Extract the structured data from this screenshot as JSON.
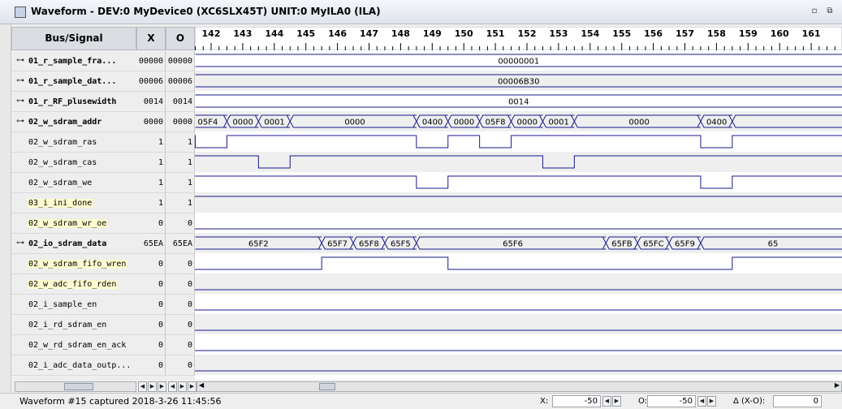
{
  "window": {
    "title": "Waveform - DEV:0 MyDevice0 (XC6SLX45T) UNIT:0 MyILA0 (ILA)",
    "minimize_glyph": "▫",
    "maximize_glyph": "⧉"
  },
  "headers": {
    "bus_signal": "Bus/Signal",
    "x": "X",
    "o": "O"
  },
  "timeline": {
    "first_tick": 142,
    "last_tick": 161,
    "tick_labels": [
      "142",
      "143",
      "144",
      "145",
      "146",
      "147",
      "148",
      "149",
      "150",
      "151",
      "152",
      "153",
      "154",
      "155",
      "156",
      "157",
      "158",
      "159",
      "160",
      "161"
    ]
  },
  "signals": [
    {
      "name": "01_r_sample_fra...",
      "bus": true,
      "highlight": false,
      "x": "00000",
      "o": "00000",
      "kind": "bus",
      "segments": [
        {
          "from": 141.5,
          "to": 162.5,
          "label": "00000001"
        }
      ]
    },
    {
      "name": "01_r_sample_dat...",
      "bus": true,
      "highlight": false,
      "x": "00006",
      "o": "00006",
      "kind": "bus",
      "segments": [
        {
          "from": 141.5,
          "to": 162.5,
          "label": "00006B30"
        }
      ]
    },
    {
      "name": "01_r_RF_plusewidth",
      "bus": true,
      "highlight": false,
      "x": "0014",
      "o": "0014",
      "kind": "bus",
      "segments": [
        {
          "from": 141.5,
          "to": 162.5,
          "label": "0014"
        }
      ]
    },
    {
      "name": "02_w_sdram_addr",
      "bus": true,
      "highlight": false,
      "x": "0000",
      "o": "0000",
      "kind": "bus",
      "segments": [
        {
          "from": 141.5,
          "to": 142.5,
          "label": "05F4"
        },
        {
          "from": 142.5,
          "to": 143.5,
          "label": "0000"
        },
        {
          "from": 143.5,
          "to": 144.5,
          "label": "0001"
        },
        {
          "from": 144.5,
          "to": 148.5,
          "label": "0000"
        },
        {
          "from": 148.5,
          "to": 149.5,
          "label": "0400"
        },
        {
          "from": 149.5,
          "to": 150.5,
          "label": "0000"
        },
        {
          "from": 150.5,
          "to": 151.5,
          "label": "05F8"
        },
        {
          "from": 151.5,
          "to": 152.5,
          "label": "0000"
        },
        {
          "from": 152.5,
          "to": 153.5,
          "label": "0001"
        },
        {
          "from": 153.5,
          "to": 157.5,
          "label": "0000"
        },
        {
          "from": 157.5,
          "to": 158.5,
          "label": "0400"
        },
        {
          "from": 158.5,
          "to": 162.5,
          "label": ""
        }
      ]
    },
    {
      "name": "02_w_sdram_ras",
      "bus": false,
      "highlight": false,
      "x": "1",
      "o": "1",
      "kind": "bit",
      "lows": [
        [
          141.5,
          142.5
        ],
        [
          148.5,
          149.5
        ],
        [
          150.5,
          151.5
        ],
        [
          157.5,
          158.5
        ]
      ]
    },
    {
      "name": "02_w_sdram_cas",
      "bus": false,
      "highlight": false,
      "x": "1",
      "o": "1",
      "kind": "bit",
      "lows": [
        [
          143.5,
          144.5
        ],
        [
          152.5,
          153.5
        ]
      ]
    },
    {
      "name": "02_w_sdram_we",
      "bus": false,
      "highlight": false,
      "x": "1",
      "o": "1",
      "kind": "bit",
      "lows": [
        [
          148.5,
          149.5
        ],
        [
          157.5,
          158.5
        ]
      ]
    },
    {
      "name": "03_i_ini_done",
      "bus": false,
      "highlight": true,
      "x": "1",
      "o": "1",
      "kind": "bit",
      "lows": []
    },
    {
      "name": "02_w_sdram_wr_oe",
      "bus": false,
      "highlight": true,
      "x": "0",
      "o": "0",
      "kind": "bit",
      "highs": []
    },
    {
      "name": "02_io_sdram_data",
      "bus": true,
      "highlight": false,
      "x": "65EA",
      "o": "65EA",
      "kind": "bus",
      "segments": [
        {
          "from": 141.5,
          "to": 145.5,
          "label": "65F2"
        },
        {
          "from": 145.5,
          "to": 146.5,
          "label": "65F7"
        },
        {
          "from": 146.5,
          "to": 147.5,
          "label": "65F8"
        },
        {
          "from": 147.5,
          "to": 148.5,
          "label": "65F5"
        },
        {
          "from": 148.5,
          "to": 154.5,
          "label": "65F6"
        },
        {
          "from": 154.5,
          "to": 155.5,
          "label": "65FB"
        },
        {
          "from": 155.5,
          "to": 156.5,
          "label": "65FC"
        },
        {
          "from": 156.5,
          "to": 157.5,
          "label": "65F9"
        },
        {
          "from": 157.5,
          "to": 162.5,
          "label": "65"
        }
      ]
    },
    {
      "name": "02_w_sdram_fifo_wren",
      "bus": false,
      "highlight": true,
      "x": "0",
      "o": "0",
      "kind": "bit",
      "highs": [
        [
          145.5,
          149.5
        ],
        [
          158.5,
          162.5
        ]
      ]
    },
    {
      "name": "02_w_adc_fifo_rden",
      "bus": false,
      "highlight": true,
      "x": "0",
      "o": "0",
      "kind": "bit",
      "highs": []
    },
    {
      "name": "02_i_sample_en",
      "bus": false,
      "highlight": false,
      "x": "0",
      "o": "0",
      "kind": "bit",
      "highs": []
    },
    {
      "name": "02_i_rd_sdram_en",
      "bus": false,
      "highlight": false,
      "x": "0",
      "o": "0",
      "kind": "bit",
      "highs": []
    },
    {
      "name": "02_w_rd_sdram_en_ack",
      "bus": false,
      "highlight": false,
      "x": "0",
      "o": "0",
      "kind": "bit",
      "highs": []
    },
    {
      "name": "02_i_adc_data_outp...",
      "bus": false,
      "highlight": false,
      "x": "0",
      "o": "0",
      "kind": "bit",
      "highs": []
    }
  ],
  "status": {
    "captured": "Waveform #15 captured 2018-3-26 11:45:56",
    "x_label": "X:",
    "x_value": "-50",
    "o_label": "O:",
    "o_value": "-50",
    "delta_label": "Δ (X-O):",
    "delta_value": "0"
  },
  "colors": {
    "wave": "#1a1a8c",
    "highlight": "#fdfccf",
    "grid_even": "#ffffff",
    "grid_odd": "#efefef"
  },
  "icons": {
    "expand": "⊶",
    "scroll_left": "◀",
    "scroll_right": "▶",
    "scroll_thumb": "|||"
  }
}
